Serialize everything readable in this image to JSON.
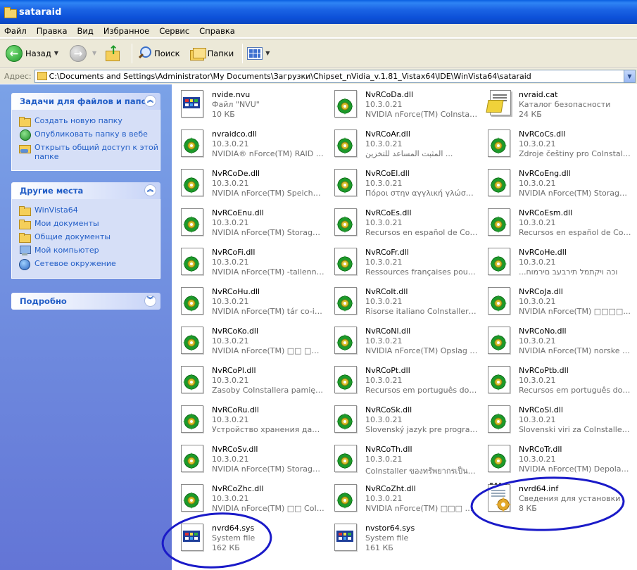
{
  "window": {
    "title": "sataraid"
  },
  "menu": [
    "Файл",
    "Правка",
    "Вид",
    "Избранное",
    "Сервис",
    "Справка"
  ],
  "toolbar": {
    "back_label": "Назад",
    "search_label": "Поиск",
    "folders_label": "Папки"
  },
  "address": {
    "label": "Адрес:",
    "path": "C:\\Documents and Settings\\Administrator\\My Documents\\Загрузки\\Chipset_nVidia_v.1.81_Vistax64\\IDE\\WinVista64\\sataraid"
  },
  "tasks_panel": {
    "title": "Задачи для файлов и папок",
    "items": [
      "Создать новую папку",
      "Опубликовать папку в вебе",
      "Открыть общий доступ к этой папке"
    ]
  },
  "places_panel": {
    "title": "Другие места",
    "items": [
      "WinVista64",
      "Мои документы",
      "Общие документы",
      "Мой компьютер",
      "Сетевое окружение"
    ]
  },
  "details_panel": {
    "title": "Подробно"
  },
  "files": [
    {
      "name": "nvide.nvu",
      "line1": "Файл \"NVU\"",
      "line2": "10 КБ",
      "icon": "doc-icon"
    },
    {
      "name": "NvRCoDa.dll",
      "line1": "10.3.0.21",
      "line2": "NVIDIA nForce(TM) CoInstaller ...",
      "icon": "dll-icon"
    },
    {
      "name": "nvraid.cat",
      "line1": "Каталог безопасности",
      "line2": "24 КБ",
      "icon": "catalog-icon"
    },
    {
      "name": "nvraidco.dll",
      "line1": "10.3.0.21",
      "line2": "NVIDIA® nForce(TM) RAID C...",
      "icon": "dll-icon"
    },
    {
      "name": "NvRCoAr.dll",
      "line1": "10.3.0.21",
      "line2": "ﺍﻟﻤﺜﺒﺖ ﺍﻟﻤﺴﺎﻋﺪ ﻟﻠﺘﺨﺰﻳﻦ ...",
      "icon": "dll-icon"
    },
    {
      "name": "NvRCoCs.dll",
      "line1": "10.3.0.21",
      "line2": "Zdroje češtiny pro CoInstaller ...",
      "icon": "dll-icon"
    },
    {
      "name": "NvRCoDe.dll",
      "line1": "10.3.0.21",
      "line2": "NVIDIA nForce(TM) Speicher ...",
      "icon": "dll-icon"
    },
    {
      "name": "NvRCoEl.dll",
      "line1": "10.3.0.21",
      "line2": "Πόροι στην αγγλική γλώσσα τ...",
      "icon": "dll-icon"
    },
    {
      "name": "NvRCoEng.dll",
      "line1": "10.3.0.21",
      "line2": "NVIDIA nForce(TM) Storage C...",
      "icon": "dll-icon"
    },
    {
      "name": "NvRCoEnu.dll",
      "line1": "10.3.0.21",
      "line2": "NVIDIA nForce(TM) Storage C...",
      "icon": "dll-icon"
    },
    {
      "name": "NvRCoEs.dll",
      "line1": "10.3.0.21",
      "line2": "Recursos en español de CoIns...",
      "icon": "dll-icon"
    },
    {
      "name": "NvRCoEsm.dll",
      "line1": "10.3.0.21",
      "line2": "Recursos en español de CoIns...",
      "icon": "dll-icon"
    },
    {
      "name": "NvRCoFi.dll",
      "line1": "10.3.0.21",
      "line2": "NVIDIA nForce(TM) -tallennuk...",
      "icon": "dll-icon"
    },
    {
      "name": "NvRCoFr.dll",
      "line1": "10.3.0.21",
      "line2": "Ressources françaises pour N...",
      "icon": "dll-icon"
    },
    {
      "name": "NvRCoHe.dll",
      "line1": "10.3.0.21",
      "line2": "...וכה ויקתמל תירבעב םירמוח",
      "icon": "dll-icon"
    },
    {
      "name": "NvRCoHu.dll",
      "line1": "10.3.0.21",
      "line2": "NVIDIA nForce(TM) tár co-inst...",
      "icon": "dll-icon"
    },
    {
      "name": "NvRCoIt.dll",
      "line1": "10.3.0.21",
      "line2": "Risorse italiano CoInstaller arc...",
      "icon": "dll-icon"
    },
    {
      "name": "NvRCoJa.dll",
      "line1": "10.3.0.21",
      "line2": "NVIDIA nForce(TM) □□□□...",
      "icon": "dll-icon"
    },
    {
      "name": "NvRCoKo.dll",
      "line1": "10.3.0.21",
      "line2": "NVIDIA nForce(TM) □□ □□ ...",
      "icon": "dll-icon"
    },
    {
      "name": "NvRCoNl.dll",
      "line1": "10.3.0.21",
      "line2": "NVIDIA nForce(TM) Opslag Co...",
      "icon": "dll-icon"
    },
    {
      "name": "NvRCoNo.dll",
      "line1": "10.3.0.21",
      "line2": "NVIDIA nForce(TM) norske Co...",
      "icon": "dll-icon"
    },
    {
      "name": "NvRCoPl.dll",
      "line1": "10.3.0.21",
      "line2": "Zasoby CoInstallera pamięci N...",
      "icon": "dll-icon"
    },
    {
      "name": "NvRCoPt.dll",
      "line1": "10.3.0.21",
      "line2": "Recursos em português do co-...",
      "icon": "dll-icon"
    },
    {
      "name": "NvRCoPtb.dll",
      "line1": "10.3.0.21",
      "line2": "Recursos em português do NV...",
      "icon": "dll-icon"
    },
    {
      "name": "NvRCoRu.dll",
      "line1": "10.3.0.21",
      "line2": "Устройство хранения данны...",
      "icon": "dll-icon"
    },
    {
      "name": "NvRCoSk.dll",
      "line1": "10.3.0.21",
      "line2": "Slovenský jazyk pre program ...",
      "icon": "dll-icon"
    },
    {
      "name": "NvRCoSl.dll",
      "line1": "10.3.0.21",
      "line2": "Slovenski viri za CoInstaller po...",
      "icon": "dll-icon"
    },
    {
      "name": "NvRCoSv.dll",
      "line1": "10.3.0.21",
      "line2": "NVIDIA nForce(TM) Storage C...",
      "icon": "dll-icon"
    },
    {
      "name": "NvRCoTh.dll",
      "line1": "10.3.0.21",
      "line2": "CoInstaller ของทรัพยากรเป็นภาษ...",
      "icon": "dll-icon"
    },
    {
      "name": "NvRCoTr.dll",
      "line1": "10.3.0.21",
      "line2": "NVIDIA nForce(TM) Depolama ...",
      "icon": "dll-icon"
    },
    {
      "name": "NvRCoZhc.dll",
      "line1": "10.3.0.21",
      "line2": "NVIDIA nForce(TM) □□ CoIn...",
      "icon": "dll-icon"
    },
    {
      "name": "NvRCoZht.dll",
      "line1": "10.3.0.21",
      "line2": "NVIDIA nForce(TM) □□□ Co...",
      "icon": "dll-icon"
    },
    {
      "name": "nvrd64.inf",
      "line1": "Сведения для установки",
      "line2": "8 КБ",
      "icon": "inf-icon"
    },
    {
      "name": "nvrd64.sys",
      "line1": "System file",
      "line2": "162 КБ",
      "icon": "doc-icon"
    },
    {
      "name": "nvstor64.sys",
      "line1": "System file",
      "line2": "161 КБ",
      "icon": "doc-icon"
    }
  ],
  "colors": {
    "titlebar": "#0c50d8",
    "taskpane": "#6375d6",
    "link": "#215dc6",
    "annotation": "#1a1ac8"
  }
}
